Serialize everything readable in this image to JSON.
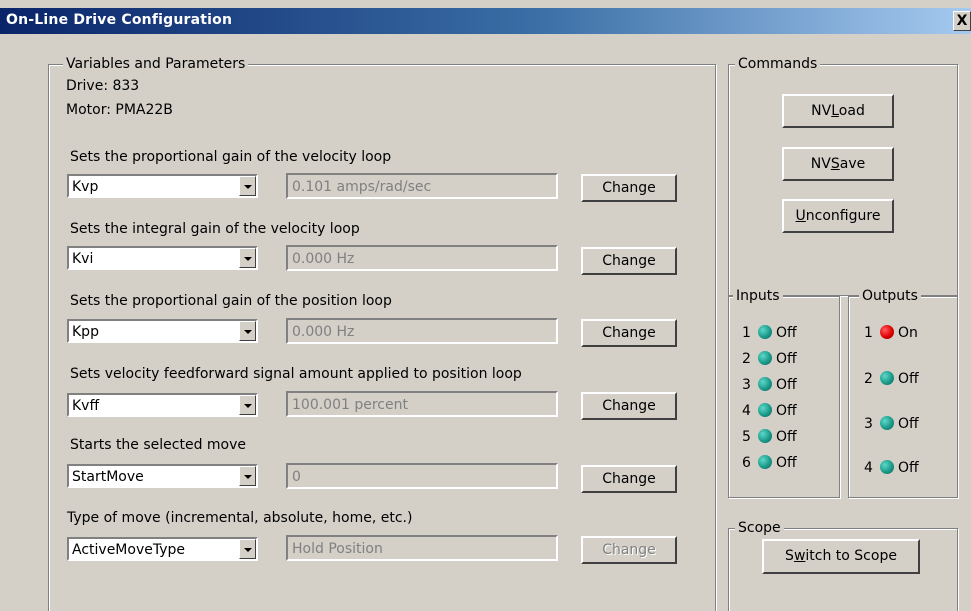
{
  "window": {
    "title": "On-Line Drive Configuration",
    "close_glyph": "X"
  },
  "variables": {
    "legend": "Variables and Parameters",
    "drive": "Drive: 833",
    "motor": "Motor: PMA22B",
    "params": [
      {
        "description": "Sets the proportional gain of the velocity loop",
        "selected": "Kvp",
        "value": "0.101 amps/rad/sec",
        "button": "Change",
        "button_enabled": true
      },
      {
        "description": "Sets the integral gain of the velocity loop",
        "selected": "Kvi",
        "value": "0.000 Hz",
        "button": "Change",
        "button_enabled": true
      },
      {
        "description": "Sets the proportional gain of the position loop",
        "selected": "Kpp",
        "value": "0.000 Hz",
        "button": "Change",
        "button_enabled": true
      },
      {
        "description": "Sets velocity feedforward signal amount applied to position loop",
        "selected": "Kvff",
        "value": "100.001 percent",
        "button": "Change",
        "button_enabled": true
      },
      {
        "description": "Starts the selected move",
        "selected": "StartMove",
        "value": "0",
        "button": "Change",
        "button_enabled": true
      },
      {
        "description": "Type of move (incremental, absolute, home, etc.)",
        "selected": "ActiveMoveType",
        "value": "Hold Position",
        "button": "Change",
        "button_enabled": false
      }
    ]
  },
  "commands": {
    "legend": "Commands",
    "nvload": {
      "pre": "NV",
      "key": "L",
      "post": "oad"
    },
    "nvsave": {
      "pre": "NV",
      "key": "S",
      "post": "ave"
    },
    "unconfigure": {
      "pre": "",
      "key": "U",
      "post": "nconfigure"
    }
  },
  "inputs": {
    "legend": "Inputs",
    "items": [
      {
        "num": "1",
        "state": "Off"
      },
      {
        "num": "2",
        "state": "Off"
      },
      {
        "num": "3",
        "state": "Off"
      },
      {
        "num": "4",
        "state": "Off"
      },
      {
        "num": "5",
        "state": "Off"
      },
      {
        "num": "6",
        "state": "Off"
      }
    ]
  },
  "outputs": {
    "legend": "Outputs",
    "items": [
      {
        "num": "1",
        "state": "On"
      },
      {
        "num": "2",
        "state": "Off"
      },
      {
        "num": "3",
        "state": "Off"
      },
      {
        "num": "4",
        "state": "Off"
      }
    ]
  },
  "scope": {
    "legend": "Scope",
    "switch": {
      "pre": "S",
      "key": "w",
      "post": "itch to Scope"
    }
  },
  "colors": {
    "led_off": "#1a9a8a",
    "led_on": "#e00000",
    "titlebar": "#0a246a"
  }
}
